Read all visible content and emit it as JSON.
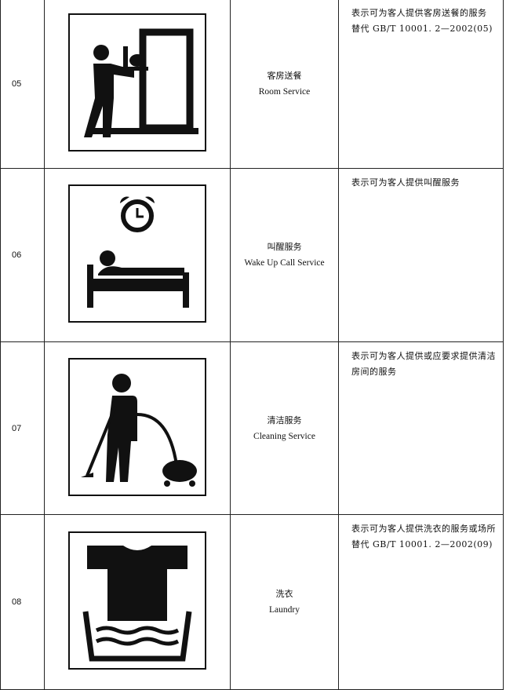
{
  "rows": [
    {
      "code": "05",
      "name_cn": "客房送餐",
      "name_en": "Room Service",
      "desc": [
        "表示可为客人提供客房送餐的服务",
        "替代 GB/T 10001. 2—2002(05)"
      ],
      "icon": "room-service-icon"
    },
    {
      "code": "06",
      "name_cn": "叫醒服务",
      "name_en": "Wake Up Call Service",
      "desc": [
        "表示可为客人提供叫醒服务"
      ],
      "icon": "wake-up-call-icon"
    },
    {
      "code": "07",
      "name_cn": "清洁服务",
      "name_en": "Cleaning Service",
      "desc": [
        "表示可为客人提供或应要求提供清洁房间的服务"
      ],
      "icon": "cleaning-service-icon"
    },
    {
      "code": "08",
      "name_cn": "洗衣",
      "name_en": "Laundry",
      "desc": [
        "表示可为客人提供洗衣的服务或场所",
        "替代 GB/T 10001. 2—2002(09)"
      ],
      "icon": "laundry-icon"
    }
  ]
}
